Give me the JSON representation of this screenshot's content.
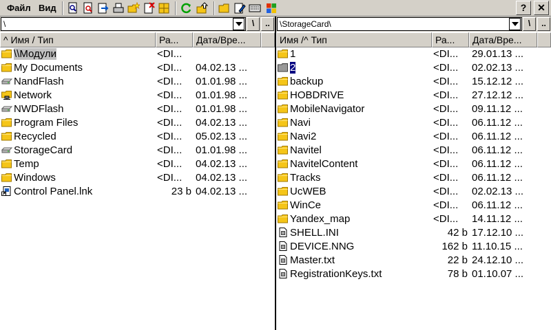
{
  "menu": {
    "file": "Файл",
    "view": "Вид"
  },
  "window_buttons": {
    "help": "?",
    "close": "✕"
  },
  "left": {
    "path": "\\",
    "up": "\\",
    "parent": "..",
    "headers": {
      "name": "^ Имя / Тип",
      "size": "Ра...",
      "date": "Дата/Вре..."
    },
    "rows": [
      {
        "name": "\\\\Модули",
        "size": "<DI...",
        "date": "",
        "icon": "folder-icon",
        "selected": true
      },
      {
        "name": "My Documents",
        "size": "<DI...",
        "date": "04.02.13 ...",
        "icon": "folder-icon"
      },
      {
        "name": "NandFlash",
        "size": "<DI...",
        "date": "01.01.98 ...",
        "icon": "drive-icon"
      },
      {
        "name": "Network",
        "size": "<DI...",
        "date": "01.01.98 ...",
        "icon": "network-icon"
      },
      {
        "name": "NWDFlash",
        "size": "<DI...",
        "date": "01.01.98 ...",
        "icon": "drive-icon"
      },
      {
        "name": "Program Files",
        "size": "<DI...",
        "date": "04.02.13 ...",
        "icon": "folder-icon"
      },
      {
        "name": "Recycled",
        "size": "<DI...",
        "date": "05.02.13 ...",
        "icon": "folder-icon"
      },
      {
        "name": "StorageCard",
        "size": "<DI...",
        "date": "01.01.98 ...",
        "icon": "drive-icon"
      },
      {
        "name": "Temp",
        "size": "<DI...",
        "date": "04.02.13 ...",
        "icon": "folder-icon"
      },
      {
        "name": "Windows",
        "size": "<DI...",
        "date": "04.02.13 ...",
        "icon": "folder-icon"
      },
      {
        "name": "Control Panel.lnk",
        "size": "23 b",
        "date": "04.02.13 ...",
        "icon": "shortcut-icon",
        "file": true
      }
    ]
  },
  "right": {
    "path": "\\StorageCard\\",
    "up": "\\",
    "parent": "..",
    "headers": {
      "name": "Имя /^ Тип",
      "size": "Ра...",
      "date": "Дата/Вре..."
    },
    "rows": [
      {
        "name": "1",
        "size": "<DI...",
        "date": "29.01.13 ...",
        "icon": "folder-icon"
      },
      {
        "name": "2",
        "size": "<DI...",
        "date": "02.02.13 ...",
        "icon": "folder-gray-icon",
        "highlight": true
      },
      {
        "name": "backup",
        "size": "<DI...",
        "date": "15.12.12 ...",
        "icon": "folder-icon"
      },
      {
        "name": "HOBDRIVE",
        "size": "<DI...",
        "date": "27.12.12 ...",
        "icon": "folder-icon"
      },
      {
        "name": "MobileNavigator",
        "size": "<DI...",
        "date": "09.11.12 ...",
        "icon": "folder-icon"
      },
      {
        "name": "Navi",
        "size": "<DI...",
        "date": "06.11.12 ...",
        "icon": "folder-icon"
      },
      {
        "name": "Navi2",
        "size": "<DI...",
        "date": "06.11.12 ...",
        "icon": "folder-icon"
      },
      {
        "name": "Navitel",
        "size": "<DI...",
        "date": "06.11.12 ...",
        "icon": "folder-icon"
      },
      {
        "name": "NavitelContent",
        "size": "<DI...",
        "date": "06.11.12 ...",
        "icon": "folder-icon"
      },
      {
        "name": "Tracks",
        "size": "<DI...",
        "date": "06.11.12 ...",
        "icon": "folder-icon"
      },
      {
        "name": "UcWEB",
        "size": "<DI...",
        "date": "02.02.13 ...",
        "icon": "folder-icon"
      },
      {
        "name": "WinCe",
        "size": "<DI...",
        "date": "06.11.12 ...",
        "icon": "folder-icon"
      },
      {
        "name": "Yandex_map",
        "size": "<DI...",
        "date": "14.11.12 ...",
        "icon": "folder-icon"
      },
      {
        "name": "SHELL.INI",
        "size": "42 b",
        "date": "17.12.10 ...",
        "icon": "text-file-icon",
        "file": true
      },
      {
        "name": "DEVICE.NNG",
        "size": "162 b",
        "date": "11.10.15 ...",
        "icon": "text-file-icon",
        "file": true
      },
      {
        "name": "Master.txt",
        "size": "22 b",
        "date": "24.12.10 ...",
        "icon": "text-file-icon",
        "file": true
      },
      {
        "name": "RegistrationKeys.txt",
        "size": "78 b",
        "date": "01.10.07 ...",
        "icon": "text-file-icon",
        "file": true
      }
    ]
  },
  "colors": {
    "chrome": "#d4d0c8",
    "folder": "#f5c518",
    "selection": "#000080"
  }
}
